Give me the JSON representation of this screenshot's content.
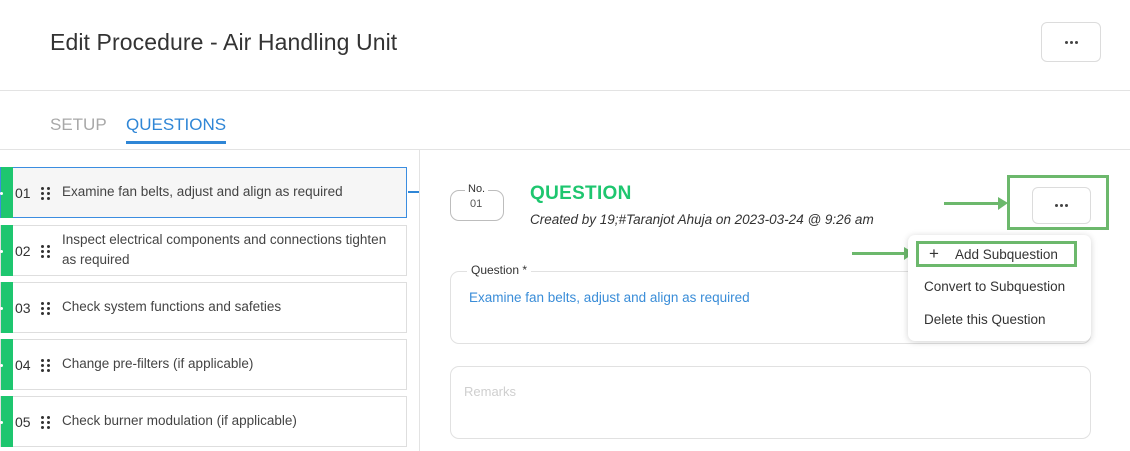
{
  "header": {
    "title": "Edit Procedure - Air Handling Unit",
    "more_icon": "ellipsis-icon"
  },
  "tabs": [
    {
      "label": "SETUP",
      "active": false
    },
    {
      "label": "QUESTIONS",
      "active": true
    }
  ],
  "questions": [
    {
      "num": "01",
      "text": "Examine fan belts, adjust and align as required",
      "active": true
    },
    {
      "num": "02",
      "text": "Inspect electrical components and connections tighten as required",
      "active": false
    },
    {
      "num": "03",
      "text": "Check system functions and safeties",
      "active": false
    },
    {
      "num": "04",
      "text": "Change pre-filters (if applicable)",
      "active": false
    },
    {
      "num": "05",
      "text": "Check burner modulation (if applicable)",
      "active": false
    }
  ],
  "detail": {
    "no_label": "No.",
    "no_value": "01",
    "heading": "QUESTION",
    "created": "Created by 19;#Taranjot Ahuja on 2023-03-24 @ 9:26 am",
    "question_label": "Question *",
    "question_value": "Examine fan belts, adjust and align as required",
    "remarks_placeholder": "Remarks"
  },
  "menu": {
    "items": [
      "Add Subquestion",
      "Convert to Subquestion",
      "Delete this Question"
    ],
    "add_icon": "plus-icon"
  },
  "colors": {
    "accent_blue": "#2f86d6",
    "status_green": "#1ec66f",
    "highlight_green": "#6cb86c"
  }
}
